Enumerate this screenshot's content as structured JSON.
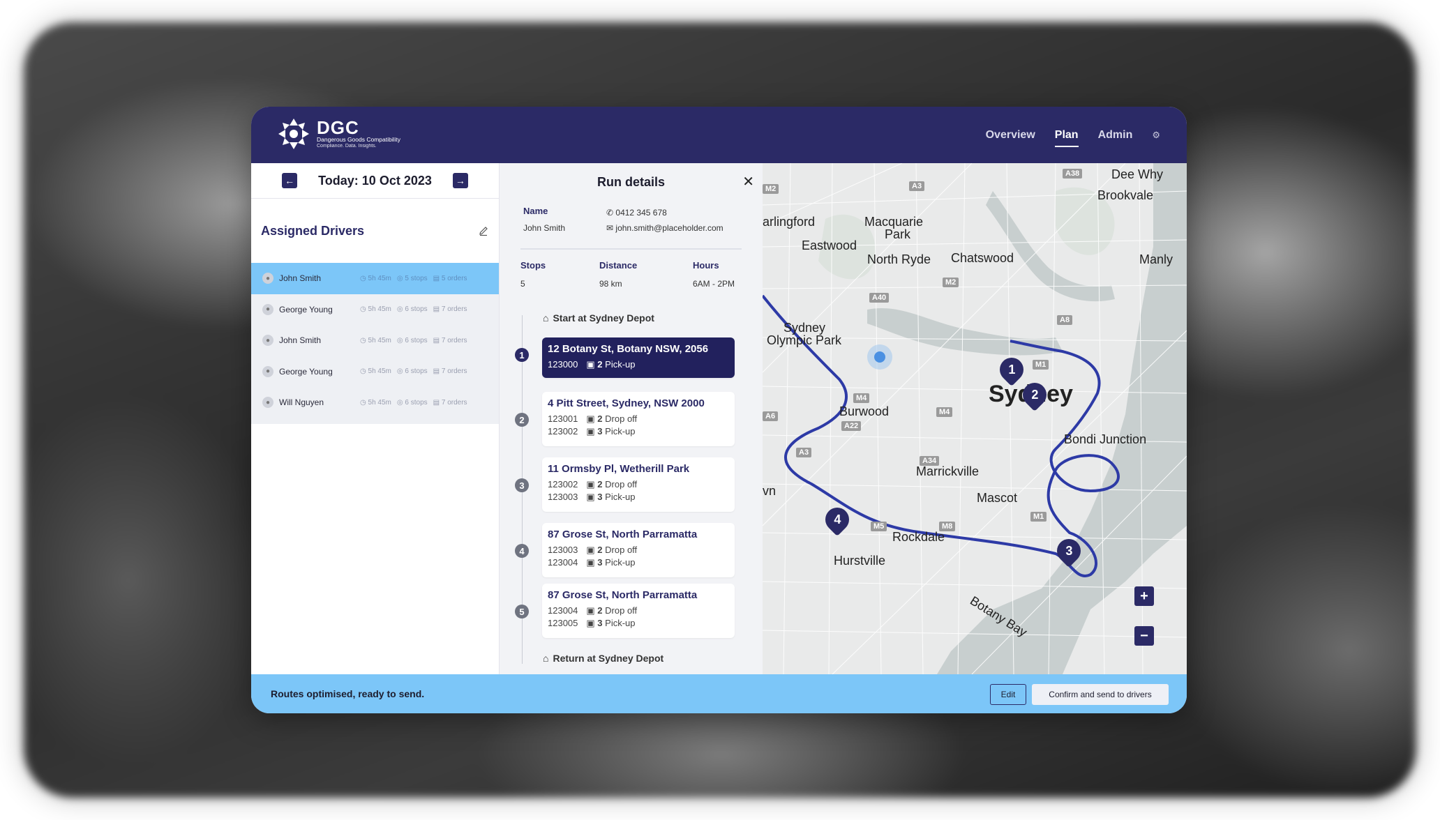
{
  "brand": {
    "name": "DGC",
    "tagline": "Dangerous Goods Compatibility",
    "subtagline": "Compliance. Data. Insights."
  },
  "nav": {
    "items": [
      {
        "label": "Overview",
        "active": false
      },
      {
        "label": "Plan",
        "active": true
      },
      {
        "label": "Admin",
        "active": false
      }
    ],
    "settings_icon": "gear-icon"
  },
  "date_bar": {
    "label": "Today: 10 Oct 2023",
    "prev_icon": "arrow-left-icon",
    "next_icon": "arrow-right-icon"
  },
  "drivers": {
    "title": "Assigned Drivers",
    "edit_icon": "pencil-icon",
    "list": [
      {
        "name": "John Smith",
        "time": "5h 45m",
        "stops": "5 stops",
        "orders": "5 orders",
        "selected": true
      },
      {
        "name": "George Young",
        "time": "5h 45m",
        "stops": "6 stops",
        "orders": "7 orders",
        "selected": false
      },
      {
        "name": "John Smith",
        "time": "5h 45m",
        "stops": "6 stops",
        "orders": "7 orders",
        "selected": false
      },
      {
        "name": "George Young",
        "time": "5h 45m",
        "stops": "6 stops",
        "orders": "7 orders",
        "selected": false
      },
      {
        "name": "Will Nguyen",
        "time": "5h 45m",
        "stops": "6 stops",
        "orders": "7 orders",
        "selected": false
      }
    ]
  },
  "run": {
    "title": "Run details",
    "name_label": "Name",
    "name": "John Smith",
    "phone": "0412 345 678",
    "email": "john.smith@placeholder.com",
    "stops_label": "Stops",
    "stops": "5",
    "distance_label": "Distance",
    "distance": "98 km",
    "hours_label": "Hours",
    "hours": "6AM - 2PM",
    "start": "Start at Sydney Depot",
    "end": "Return at Sydney Depot",
    "stops_list": [
      {
        "num": "1",
        "address": "12 Botany St, Botany NSW, 2056",
        "lines": [
          {
            "order": "123000",
            "count": "2",
            "type": "Pick-up"
          }
        ],
        "active": true
      },
      {
        "num": "2",
        "address": "4 Pitt Street, Sydney, NSW 2000",
        "lines": [
          {
            "order": "123001",
            "count": "2",
            "type": "Drop off"
          },
          {
            "order": "123002",
            "count": "3",
            "type": "Pick-up"
          }
        ],
        "active": false
      },
      {
        "num": "3",
        "address": "11 Ormsby Pl, Wetherill Park",
        "lines": [
          {
            "order": "123002",
            "count": "2",
            "type": "Drop off"
          },
          {
            "order": "123003",
            "count": "3",
            "type": "Pick-up"
          }
        ],
        "active": false
      },
      {
        "num": "4",
        "address": "87 Grose St, North Parramatta",
        "lines": [
          {
            "order": "123003",
            "count": "2",
            "type": "Drop off"
          },
          {
            "order": "123004",
            "count": "3",
            "type": "Pick-up"
          }
        ],
        "active": false
      },
      {
        "num": "5",
        "address": "87 Grose St, North Parramatta",
        "lines": [
          {
            "order": "123004",
            "count": "2",
            "type": "Drop off"
          },
          {
            "order": "123005",
            "count": "3",
            "type": "Pick-up"
          }
        ],
        "active": false
      }
    ]
  },
  "map": {
    "labels": [
      "Dee Why",
      "Brookvale",
      "arlingford",
      "Macquarie",
      "Park",
      "Eastwood",
      "North Ryde",
      "Chatswood",
      "Manly",
      "Sydney",
      "Olympic Park",
      "Burwood",
      "Sydney",
      "Bondi Junction",
      "Marrickville",
      "Mascot",
      "Rockdale",
      "Hurstville",
      "Botany Bay",
      "vn"
    ],
    "shields": [
      "A38",
      "A3",
      "M2",
      "A40",
      "M2",
      "A8",
      "M1",
      "M4",
      "A6",
      "M4",
      "A3",
      "A34",
      "M5",
      "M8",
      "M1",
      "A22"
    ],
    "pins": [
      "1",
      "2",
      "3",
      "4"
    ],
    "zoom_in": "+",
    "zoom_out": "−"
  },
  "footer": {
    "message": "Routes optimised, ready to send.",
    "edit_label": "Edit",
    "confirm_label": "Confirm and send to drivers"
  },
  "colors": {
    "primary": "#2b2a66",
    "accent": "#7cc6f8",
    "route": "#2d3aa6"
  }
}
